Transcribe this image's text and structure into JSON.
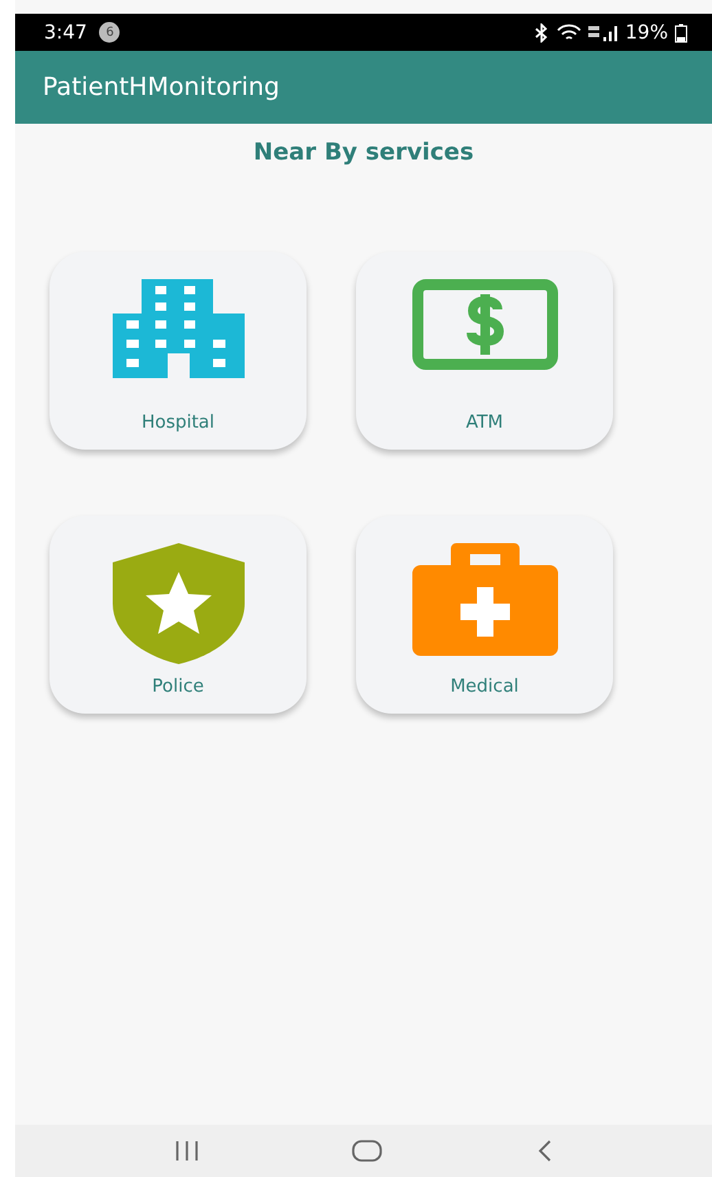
{
  "status_bar": {
    "time": "3:47",
    "notification_count": "6",
    "battery": "19%"
  },
  "app_bar": {
    "title": "PatientHMonitoring"
  },
  "heading": "Near By services",
  "services": [
    {
      "label": "Hospital",
      "kind": "building"
    },
    {
      "label": "ATM",
      "kind": "money"
    },
    {
      "label": "Police",
      "kind": "shield"
    },
    {
      "label": "Medical",
      "kind": "briefcase"
    }
  ]
}
